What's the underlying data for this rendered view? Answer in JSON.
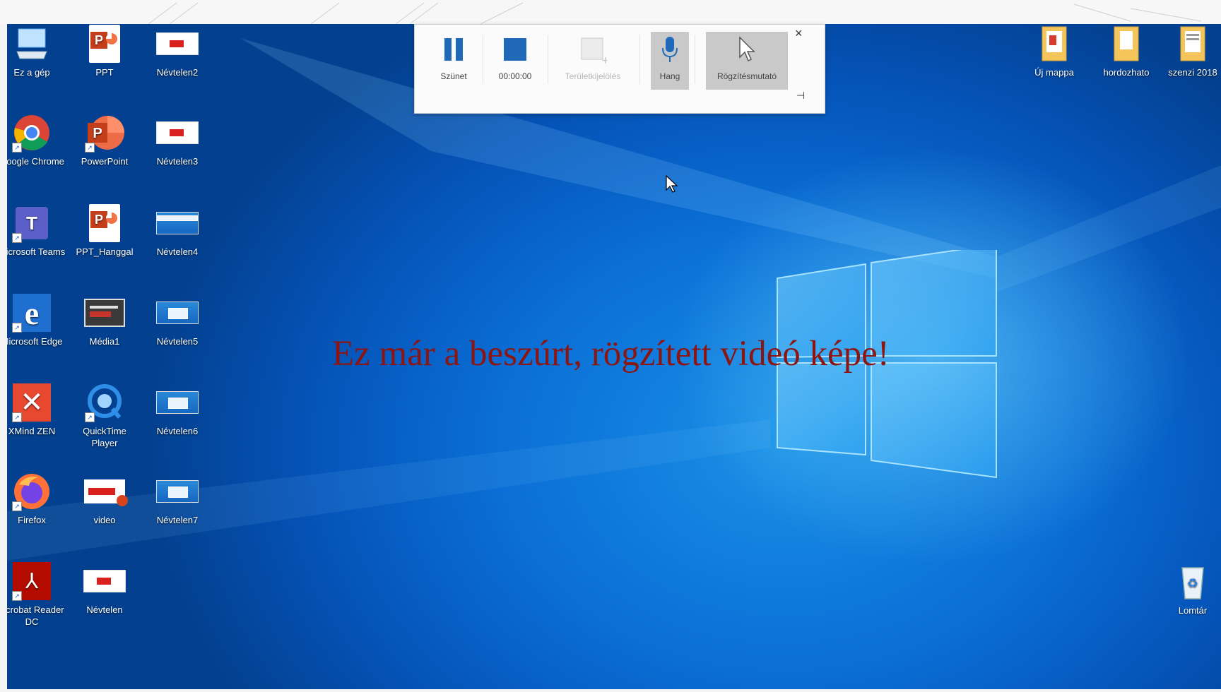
{
  "recording_toolbar": {
    "pause_label": "Szünet",
    "timer": "00:00:00",
    "area_select_label": "Területkijelölés",
    "audio_label": "Hang",
    "pointer_label": "Rögzítésmutató",
    "close_symbol": "×",
    "pin_symbol": "⊣"
  },
  "caption": "Ez már a beszúrt, rögzített videó képe!",
  "desktop_icons_left": [
    {
      "label": "Ez a gép",
      "icon": "computer-icon"
    },
    {
      "label": "PPT",
      "icon": "powerpoint-file-icon"
    },
    {
      "label": "Névtelen2",
      "icon": "video-thumbnail-icon"
    },
    {
      "label": "Google Chrome",
      "icon": "chrome-icon"
    },
    {
      "label": "PowerPoint",
      "icon": "powerpoint-app-icon"
    },
    {
      "label": "Névtelen3",
      "icon": "video-thumbnail-icon"
    },
    {
      "label": "Microsoft Teams",
      "icon": "teams-icon"
    },
    {
      "label": "PPT_Hanggal",
      "icon": "powerpoint-file-icon"
    },
    {
      "label": "Névtelen4",
      "icon": "video-thumbnail-icon"
    },
    {
      "label": "Microsoft Edge",
      "icon": "edge-icon"
    },
    {
      "label": "Média1",
      "icon": "media-file-icon"
    },
    {
      "label": "Névtelen5",
      "icon": "video-thumbnail-icon"
    },
    {
      "label": "XMind ZEN",
      "icon": "xmind-icon"
    },
    {
      "label": "QuickTime Player",
      "icon": "quicktime-icon"
    },
    {
      "label": "Névtelen6",
      "icon": "video-thumbnail-icon"
    },
    {
      "label": "Firefox",
      "icon": "firefox-icon"
    },
    {
      "label": "video",
      "icon": "video-file-icon"
    },
    {
      "label": "Névtelen7",
      "icon": "video-thumbnail-icon"
    },
    {
      "label": "Acrobat Reader DC",
      "icon": "acrobat-icon"
    },
    {
      "label": "Névtelen",
      "icon": "video-thumbnail-icon"
    }
  ],
  "desktop_icons_right": [
    {
      "label": "Új mappa",
      "icon": "folder-icon"
    },
    {
      "label": "hordozhato",
      "icon": "folder-icon"
    },
    {
      "label": "szenzi 2018",
      "icon": "folder-icon"
    },
    {
      "label": "Lomtár",
      "icon": "recycle-bin-icon"
    }
  ],
  "colors": {
    "caption": "#8c1512",
    "desktop_blue": "#0a6fd6"
  }
}
